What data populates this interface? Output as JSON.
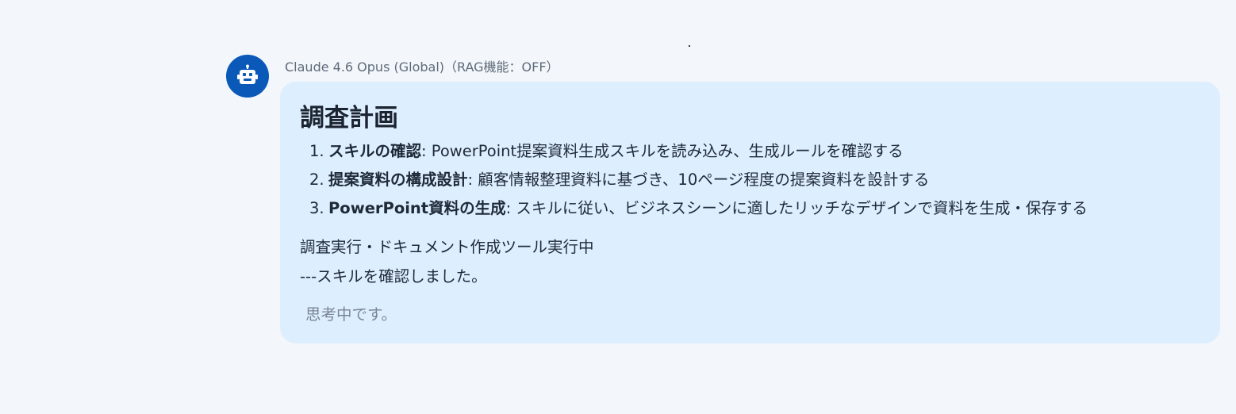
{
  "message": {
    "avatar_icon": "robot-icon",
    "sender": "Claude 4.6 Opus (Global)（RAG機能：OFF）",
    "title": "調査計画",
    "plan": [
      {
        "number": "1.",
        "heading": "スキルの確認",
        "text": ": PowerPoint提案資料生成スキルを読み込み、生成ルールを確認する"
      },
      {
        "number": "2.",
        "heading": "提案資料の構成設計",
        "text": ": 顧客情報整理資料に基づき、10ページ程度の提案資料を設計する"
      },
      {
        "number": "3.",
        "heading": "PowerPoint資料の生成",
        "text": ": スキルに従い、ビジネスシーンに適したリッチなデザインで資料を生成・保存する"
      }
    ],
    "status_line": "調査実行・ドキュメント作成ツール実行中",
    "result_line": "---スキルを確認しました。",
    "thinking": "思考中です。"
  },
  "colors": {
    "background": "#f3f6fa",
    "bubble": "#ddeeff",
    "avatar": "#0a58b8",
    "text": "#1f2a37",
    "muted": "#7b8594"
  }
}
